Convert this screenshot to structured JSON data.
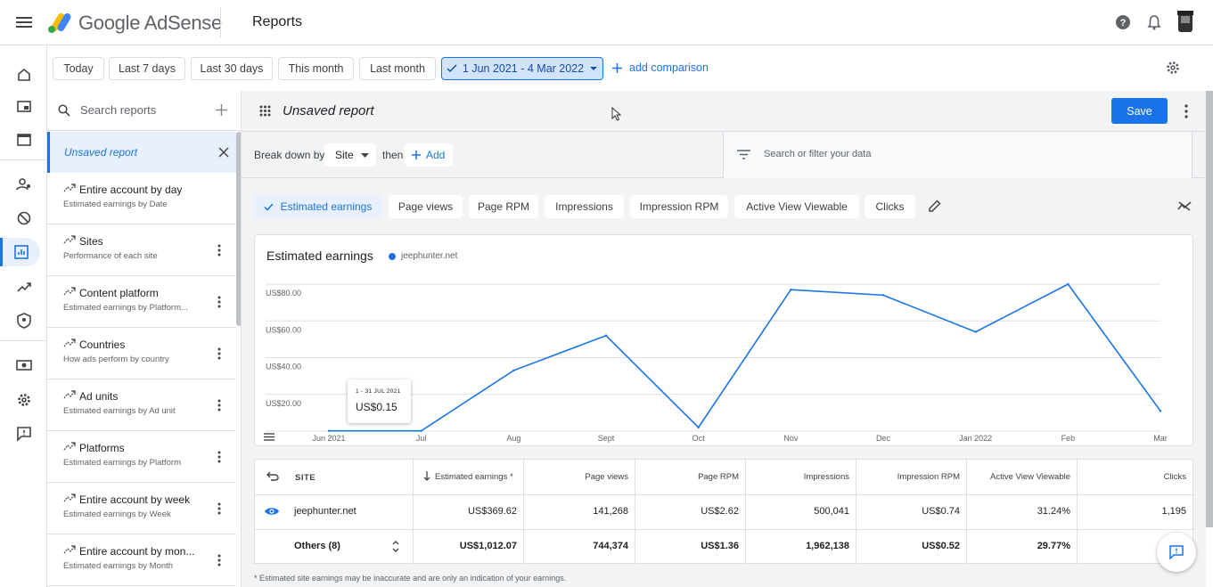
{
  "app": {
    "brand": "Google AdSense",
    "page_title": "Reports"
  },
  "date_ranges": [
    {
      "label": "Today"
    },
    {
      "label": "Last 7 days"
    },
    {
      "label": "Last 30 days"
    },
    {
      "label": "This month"
    },
    {
      "label": "Last month"
    },
    {
      "label": "1 Jun 2021 - 4 Mar 2022",
      "selected": true
    }
  ],
  "add_comparison": "add comparison",
  "left_panel": {
    "search_placeholder": "Search reports",
    "unsaved": "Unsaved report",
    "reports": [
      {
        "title": "Entire account by day",
        "subtitle": "Estimated earnings by Date"
      },
      {
        "title": "Sites",
        "subtitle": "Performance of each site"
      },
      {
        "title": "Content platform",
        "subtitle": "Estimated earnings by Platform..."
      },
      {
        "title": "Countries",
        "subtitle": "How ads perform by country"
      },
      {
        "title": "Ad units",
        "subtitle": "Estimated earnings by Ad unit"
      },
      {
        "title": "Platforms",
        "subtitle": "Estimated earnings by Platform"
      },
      {
        "title": "Entire account by week",
        "subtitle": "Estimated earnings by Week"
      },
      {
        "title": "Entire account by mon...",
        "subtitle": "Estimated earnings by Month"
      }
    ]
  },
  "main": {
    "report_name": "Unsaved report",
    "save": "Save",
    "breakdown_label": "Break down by",
    "breakdown_value": "Site",
    "then": "then",
    "add": "Add",
    "filter_placeholder": "Search or filter your data",
    "metrics": [
      {
        "label": "Estimated earnings",
        "selected": true
      },
      {
        "label": "Page views"
      },
      {
        "label": "Page RPM"
      },
      {
        "label": "Impressions"
      },
      {
        "label": "Impression RPM"
      },
      {
        "label": "Active View Viewable"
      },
      {
        "label": "Clicks"
      }
    ]
  },
  "chart_data": {
    "type": "line",
    "title": "Estimated earnings",
    "series": [
      {
        "name": "jeephunter.net",
        "color": "#1a73e8",
        "values": [
          0.15,
          0.15,
          33,
          52,
          2,
          77,
          74,
          54,
          80,
          11
        ]
      }
    ],
    "x": [
      "Jun 2021",
      "Jul",
      "Aug",
      "Sept",
      "Oct",
      "Nov",
      "Dec",
      "Jan 2022",
      "Feb",
      "Mar"
    ],
    "y_ticks": [
      "US$80.00",
      "US$60.00",
      "US$40.00",
      "US$20.00"
    ],
    "ylim": [
      0,
      80
    ],
    "grid": true,
    "tooltip": {
      "date": "1 - 31 JUL 2021",
      "value": "US$0.15"
    }
  },
  "table": {
    "headers": [
      "SITE",
      "Estimated earnings *",
      "Page views",
      "Page RPM",
      "Impressions",
      "Impression RPM",
      "Active View Viewable",
      "Clicks"
    ],
    "rows": [
      [
        "jeephunter.net",
        "US$369.62",
        "141,268",
        "US$2.62",
        "500,041",
        "US$0.74",
        "31.24%",
        "1,195"
      ],
      [
        "Others (8)",
        "US$1,012.07",
        "744,374",
        "US$1.36",
        "1,962,138",
        "US$0.52",
        "29.77%",
        ""
      ]
    ]
  },
  "footnote": "* Estimated site earnings may be inaccurate and are only an indication of your earnings."
}
